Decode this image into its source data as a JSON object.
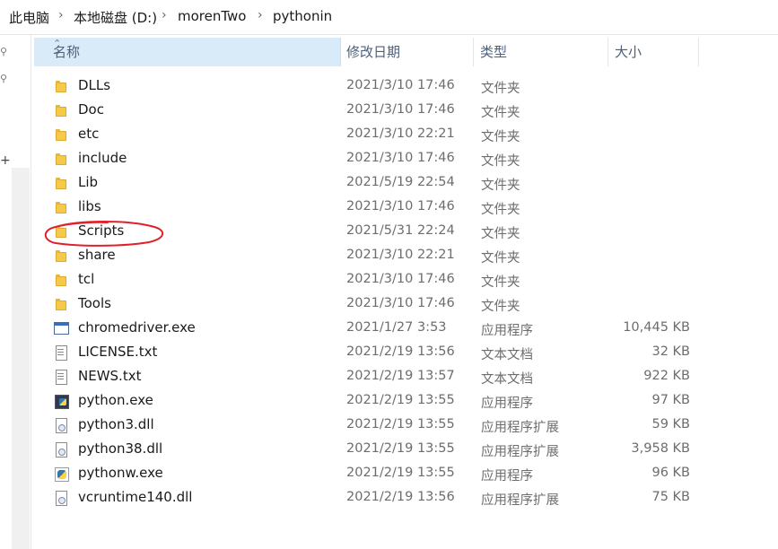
{
  "breadcrumb": {
    "items": [
      "此电脑",
      "本地磁盘 (D:)",
      "morenTwo",
      "pythonin"
    ],
    "separator": "›"
  },
  "columns": {
    "name": "名称",
    "date": "修改日期",
    "type": "类型",
    "size": "大小"
  },
  "files": [
    {
      "name": "DLLs",
      "date": "2021/3/10 17:46",
      "type": "文件夹",
      "size": "",
      "icon": "folder-icon"
    },
    {
      "name": "Doc",
      "date": "2021/3/10 17:46",
      "type": "文件夹",
      "size": "",
      "icon": "folder-icon"
    },
    {
      "name": "etc",
      "date": "2021/3/10 22:21",
      "type": "文件夹",
      "size": "",
      "icon": "folder-icon"
    },
    {
      "name": "include",
      "date": "2021/3/10 17:46",
      "type": "文件夹",
      "size": "",
      "icon": "folder-icon"
    },
    {
      "name": "Lib",
      "date": "2021/5/19 22:54",
      "type": "文件夹",
      "size": "",
      "icon": "folder-icon"
    },
    {
      "name": "libs",
      "date": "2021/3/10 17:46",
      "type": "文件夹",
      "size": "",
      "icon": "folder-icon"
    },
    {
      "name": "Scripts",
      "date": "2021/5/31 22:24",
      "type": "文件夹",
      "size": "",
      "icon": "folder-icon"
    },
    {
      "name": "share",
      "date": "2021/3/10 22:21",
      "type": "文件夹",
      "size": "",
      "icon": "folder-icon"
    },
    {
      "name": "tcl",
      "date": "2021/3/10 17:46",
      "type": "文件夹",
      "size": "",
      "icon": "folder-icon"
    },
    {
      "name": "Tools",
      "date": "2021/3/10 17:46",
      "type": "文件夹",
      "size": "",
      "icon": "folder-icon"
    },
    {
      "name": "chromedriver.exe",
      "date": "2021/1/27 3:53",
      "type": "应用程序",
      "size": "10,445 KB",
      "icon": "exe-icon"
    },
    {
      "name": "LICENSE.txt",
      "date": "2021/2/19 13:56",
      "type": "文本文档",
      "size": "32 KB",
      "icon": "text-file-icon"
    },
    {
      "name": "NEWS.txt",
      "date": "2021/2/19 13:57",
      "type": "文本文档",
      "size": "922 KB",
      "icon": "text-file-icon"
    },
    {
      "name": "python.exe",
      "date": "2021/2/19 13:55",
      "type": "应用程序",
      "size": "97 KB",
      "icon": "python-icon"
    },
    {
      "name": "python3.dll",
      "date": "2021/2/19 13:55",
      "type": "应用程序扩展",
      "size": "59 KB",
      "icon": "dll-icon"
    },
    {
      "name": "python38.dll",
      "date": "2021/2/19 13:55",
      "type": "应用程序扩展",
      "size": "3,958 KB",
      "icon": "dll-icon"
    },
    {
      "name": "pythonw.exe",
      "date": "2021/2/19 13:55",
      "type": "应用程序",
      "size": "96 KB",
      "icon": "pythonw-icon"
    },
    {
      "name": "vcruntime140.dll",
      "date": "2021/2/19 13:56",
      "type": "应用程序扩展",
      "size": "75 KB",
      "icon": "dll-icon"
    }
  ],
  "colors": {
    "header_selected": "#d9ebf9",
    "annotation": "#e0202a"
  }
}
